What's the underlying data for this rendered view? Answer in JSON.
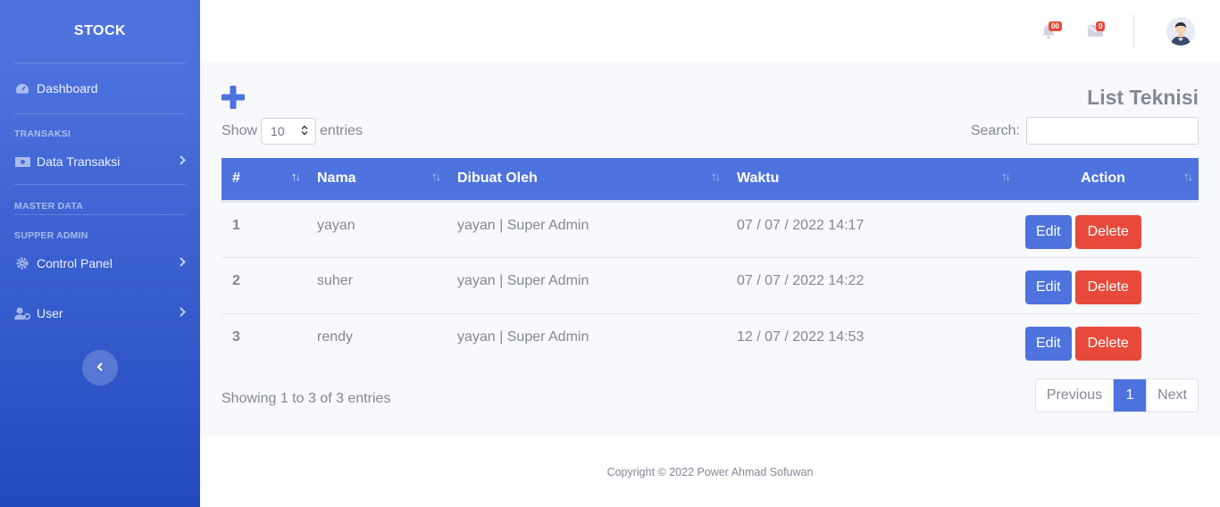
{
  "sidebar": {
    "brand": "STOCK",
    "dashboard": "Dashboard",
    "heading_transaksi": "TRANSAKSI",
    "data_transaksi": "Data Transaksi",
    "heading_master": "MASTER DATA",
    "heading_supper": "SUPPER ADMIN",
    "control_panel": "Control Panel",
    "user": "User"
  },
  "topbar": {
    "alerts_count": "00",
    "messages_count": "0"
  },
  "page": {
    "title": "List Teknisi",
    "show_label": "Show",
    "entries_value": "10",
    "entries_label": "entries",
    "search_label": "Search:",
    "search_value": ""
  },
  "table": {
    "headers": [
      "#",
      "Nama",
      "Dibuat Oleh",
      "Waktu",
      "Action"
    ],
    "rows": [
      {
        "num": "1",
        "nama": "yayan",
        "dibuat": "yayan | Super Admin",
        "waktu": "07 / 07 / 2022 14:17"
      },
      {
        "num": "2",
        "nama": "suher",
        "dibuat": "yayan | Super Admin",
        "waktu": "07 / 07 / 2022 14:22"
      },
      {
        "num": "3",
        "nama": "rendy",
        "dibuat": "yayan | Super Admin",
        "waktu": "12 / 07 / 2022 14:53"
      }
    ],
    "edit_label": "Edit",
    "delete_label": "Delete"
  },
  "pagination": {
    "info": "Showing 1 to 3 of 3 entries",
    "previous": "Previous",
    "current": "1",
    "next": "Next"
  },
  "footer": {
    "text": "Copyright © 2022 Power Ahmad Sofuwan"
  },
  "colors": {
    "primary": "#4e73df",
    "danger": "#e74a3b"
  }
}
